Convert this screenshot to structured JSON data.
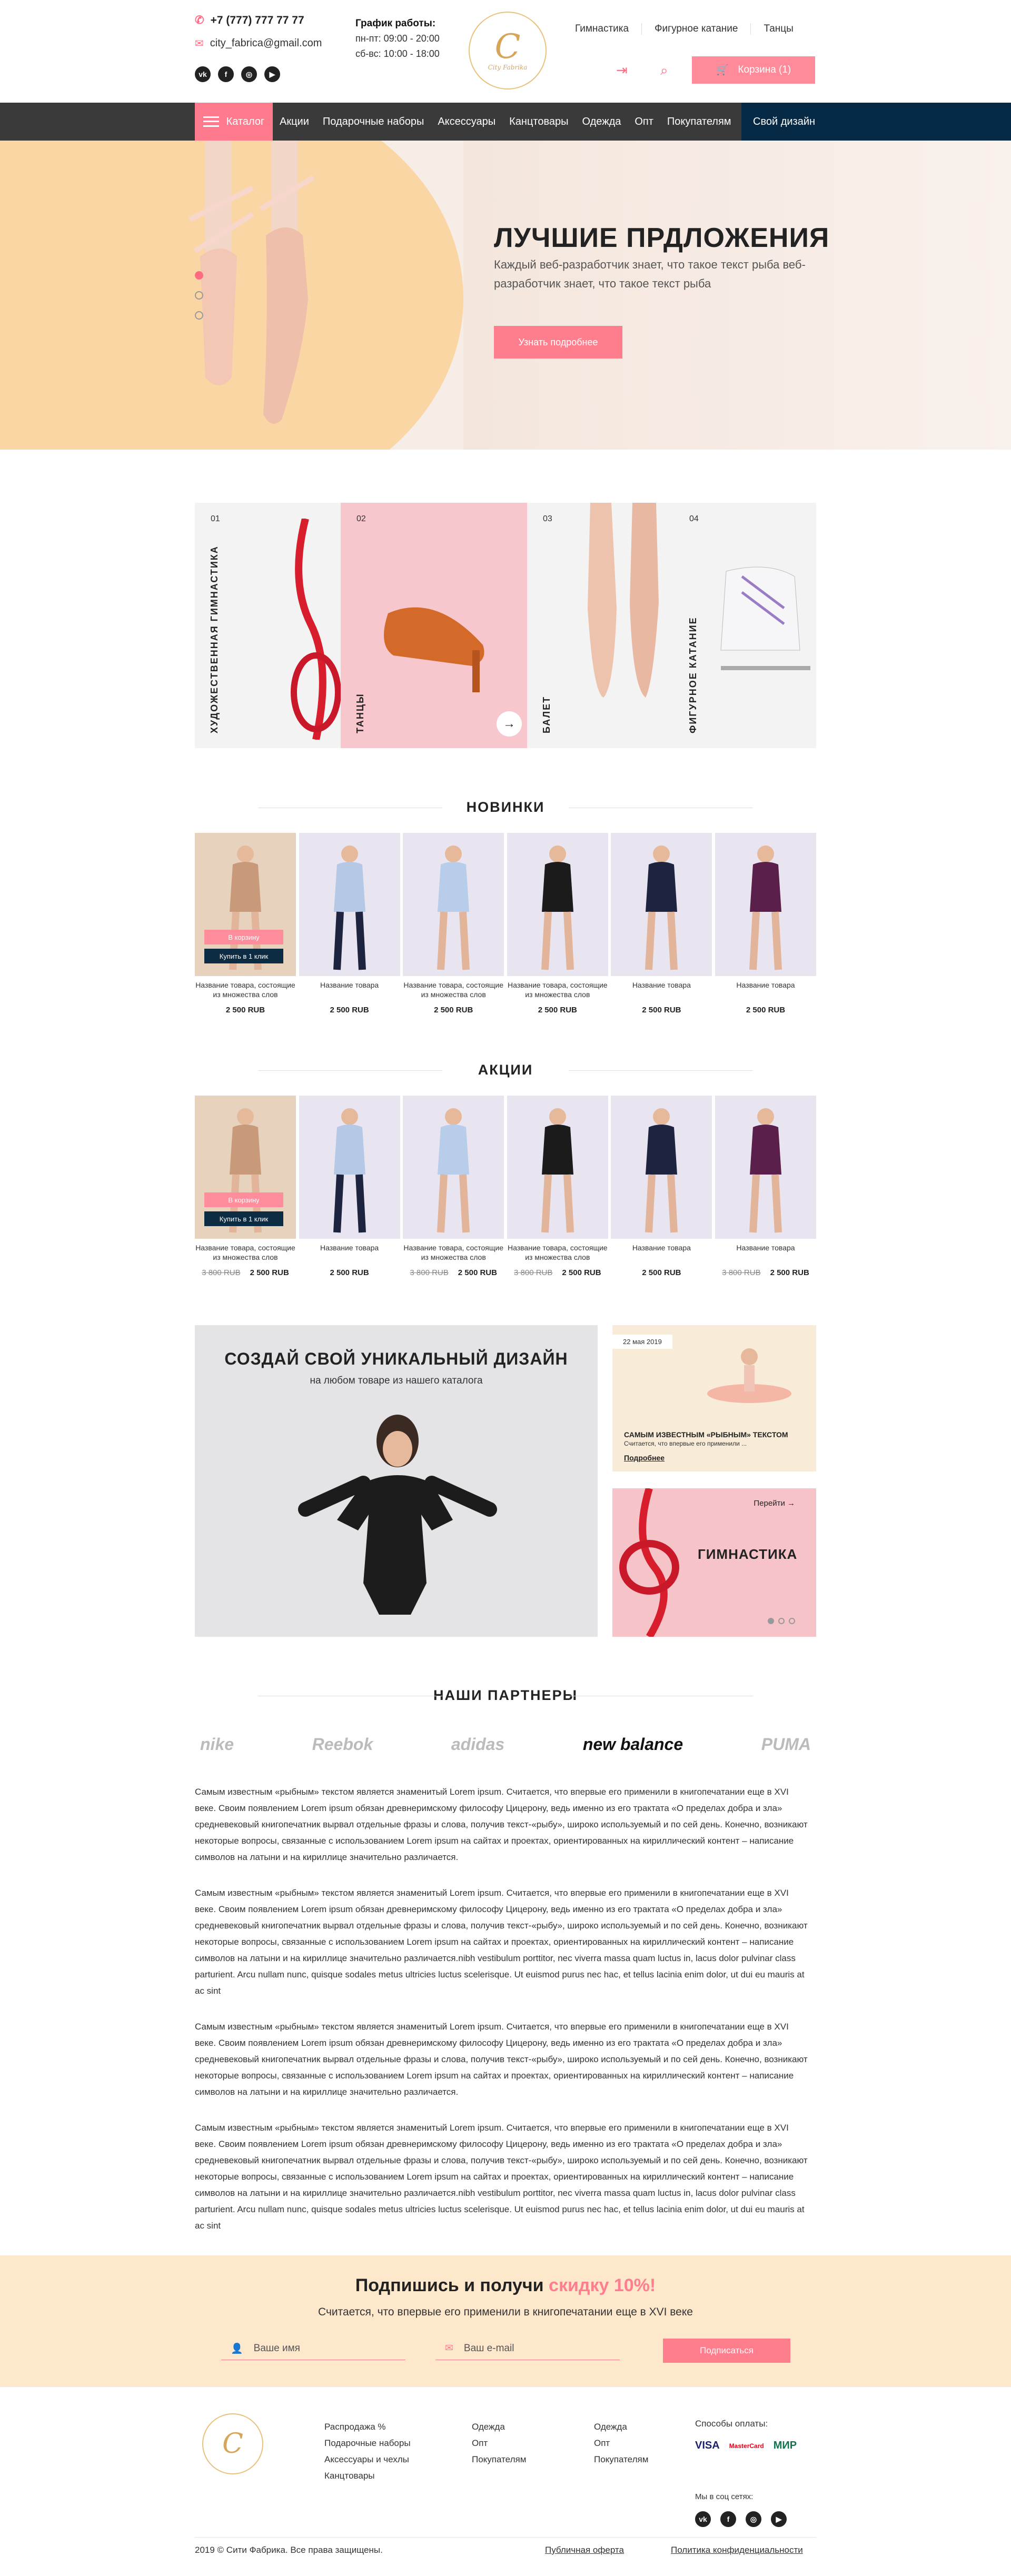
{
  "header": {
    "phone": "+7 (777) 777 77 77",
    "email": "city_fabrica@gmail.com",
    "social": [
      "vk",
      "f",
      "ig",
      "yt"
    ],
    "schedule_title": "График работы:",
    "schedule_1": "пн-пт: 09:00 - 20:00",
    "schedule_2": "сб-вс: 10:00 - 18:00",
    "top_nav": [
      "Гимнастика",
      "Фигурное катание",
      "Танцы"
    ],
    "cart_label": "Корзина (1)"
  },
  "nav": {
    "catalog": "Каталог",
    "items": [
      "Акции",
      "Подарочные наборы",
      "Аксессуары",
      "Канцтовары",
      "Одежда",
      "Опт",
      "Покупателям"
    ],
    "design": "Свой дизайн"
  },
  "hero": {
    "title": "ЛУЧШИЕ ПРДЛОЖЕНИЯ",
    "text": "Каждый веб-разработчик знает, что такое текст рыба веб-разработчик знает, что такое текст рыба",
    "button": "Узнать подробнее"
  },
  "categories": [
    {
      "num": "01",
      "label": "ХУДОЖЕСТВЕННАЯ ГИМНАСТИКА"
    },
    {
      "num": "02",
      "label": "ТАНЦЫ"
    },
    {
      "num": "03",
      "label": "БАЛЕТ"
    },
    {
      "num": "04",
      "label": "ФИГУРНОЕ КАТАНИЕ"
    }
  ],
  "new_title": "НОВИНКИ",
  "sale_title": "АКЦИИ",
  "overlay": {
    "cart": "В корзину",
    "buy": "Купить в 1 клик"
  },
  "new_products": [
    {
      "name": "Название товара, состоящие из множества слов",
      "price": "2 500 RUB"
    },
    {
      "name": "Название товара",
      "price": "2 500 RUB"
    },
    {
      "name": "Название товара, состоящие из множества слов",
      "price": "2 500 RUB"
    },
    {
      "name": "Название товара, состоящие из множества слов",
      "price": "2 500 RUB"
    },
    {
      "name": "Название товара",
      "price": "2 500 RUB"
    },
    {
      "name": "Название товара",
      "price": "2 500 RUB"
    }
  ],
  "sale_products": [
    {
      "name": "Название товара, состоящие из множества слов",
      "old": "3 800 RUB",
      "price": "2 500 RUB"
    },
    {
      "name": "Название товара",
      "old": "",
      "price": "2 500 RUB"
    },
    {
      "name": "Название товара, состоящие из множества слов",
      "old": "3 800 RUB",
      "price": "2 500 RUB"
    },
    {
      "name": "Название товара, состоящие из множества слов",
      "old": "3 800 RUB",
      "price": "2 500 RUB"
    },
    {
      "name": "Название товара",
      "old": "",
      "price": "2 500 RUB"
    },
    {
      "name": "Название товара",
      "old": "3 800 RUB",
      "price": "2 500 RUB"
    }
  ],
  "promo": {
    "title": "СОЗДАЙ СВОЙ УНИКАЛЬНЫЙ ДИЗАЙН",
    "subtitle": "на любом товаре из нашего каталога"
  },
  "news": {
    "date": "22 мая 2019",
    "title": "САМЫМ ИЗВЕСТНЫМ «РЫБНЫМ» ТЕКСТОМ",
    "desc": "Считается, что впервые его применили ...",
    "more": "Подробнее"
  },
  "gym": {
    "link": "Перейти",
    "title": "ГИМНАСТИКА"
  },
  "partners_title": "НАШИ ПАРТНЕРЫ",
  "partners": [
    "nike",
    "Reebok",
    "adidas",
    "new balance",
    "PUMA"
  ],
  "text_blocks": [
    "Самым известным «рыбным» текстом является знаменитый Lorem ipsum. Считается, что впервые его применили в книгопечатании еще в XVI веке. Своим появлением Lorem ipsum обязан древнеримскому философу Цицерону, ведь именно из его трактата «О пределах добра и зла» средневековый книгопечатник вырвал отдельные фразы и слова, получив текст-«рыбу», широко используемый и по сей день. Конечно, возникают некоторые вопросы, связанные с использованием Lorem ipsum на сайтах и проектах, ориентированных на кириллический контент – написание символов на латыни и на кириллице значительно различается.",
    "Самым известным «рыбным» текстом является знаменитый Lorem ipsum. Считается, что впервые его применили в книгопечатании еще в XVI веке. Своим появлением Lorem ipsum обязан древнеримскому философу Цицерону, ведь именно из его трактата «О пределах добра и зла» средневековый книгопечатник вырвал отдельные фразы и слова, получив текст-«рыбу», широко используемый и по сей день. Конечно, возникают некоторые вопросы, связанные с использованием Lorem ipsum на сайтах и проектах, ориентированных на кириллический контент – написание символов на латыни и на кириллице значительно различается.nibh vestibulum porttitor, nec viverra massa quam luctus in, lacus dolor pulvinar class parturient. Arcu nullam nunc, quisque sodales metus ultricies luctus scelerisque. Ut euismod purus nec hac, et tellus lacinia enim dolor, ut dui eu mauris at ac sint",
    "Самым известным «рыбным» текстом является знаменитый Lorem ipsum. Считается, что впервые его применили в книгопечатании еще в XVI веке. Своим появлением Lorem ipsum обязан древнеримскому философу Цицерону, ведь именно из его трактата «О пределах добра и зла» средневековый книгопечатник вырвал отдельные фразы и слова, получив текст-«рыбу», широко используемый и по сей день. Конечно, возникают некоторые вопросы, связанные с использованием Lorem ipsum на сайтах и проектах, ориентированных на кириллический контент – написание символов на латыни и на кириллице значительно различается.",
    "Самым известным «рыбным» текстом является знаменитый Lorem ipsum. Считается, что впервые его применили в книгопечатании еще в XVI веке. Своим появлением Lorem ipsum обязан древнеримскому философу Цицерону, ведь именно из его трактата «О пределах добра и зла» средневековый книгопечатник вырвал отдельные фразы и слова, получив текст-«рыбу», широко используемый и по сей день. Конечно, возникают некоторые вопросы, связанные с использованием Lorem ipsum на сайтах и проектах, ориентированных на кириллический контент – написание символов на латыни и на кириллице значительно различается.nibh vestibulum porttitor, nec viverra massa quam luctus in, lacus dolor pulvinar class parturient. Arcu nullam nunc, quisque sodales metus ultricies luctus scelerisque. Ut euismod purus nec hac, et tellus lacinia enim dolor, ut dui eu mauris at ac sint"
  ],
  "subscribe": {
    "title": "Подпишись и получи ",
    "highlight": "скидку 10%!",
    "text": "Считается, что впервые его применили в книгопечатании еще в XVI веке",
    "name_placeholder": "Ваше имя",
    "email_placeholder": "Ваш e-mail",
    "button": "Подписаться"
  },
  "footer": {
    "col1": [
      "Распродажа %",
      "Подарочные наборы",
      "Аксессуары и чехлы",
      "Канцтовары"
    ],
    "col2": [
      "Одежда",
      "Опт",
      "Покупателям"
    ],
    "col3": [
      "Одежда",
      "Опт",
      "Покупателям"
    ],
    "pay_title": "Способы оплаты:",
    "pays": [
      "VISA",
      "MasterCard",
      "МИР"
    ],
    "social_title": "Мы в соц сетях:",
    "copyright": "2019 © Сити Фабрика. Все права защищены.",
    "offer": "Публичная оферта",
    "privacy": "Политика конфиденциальности"
  }
}
